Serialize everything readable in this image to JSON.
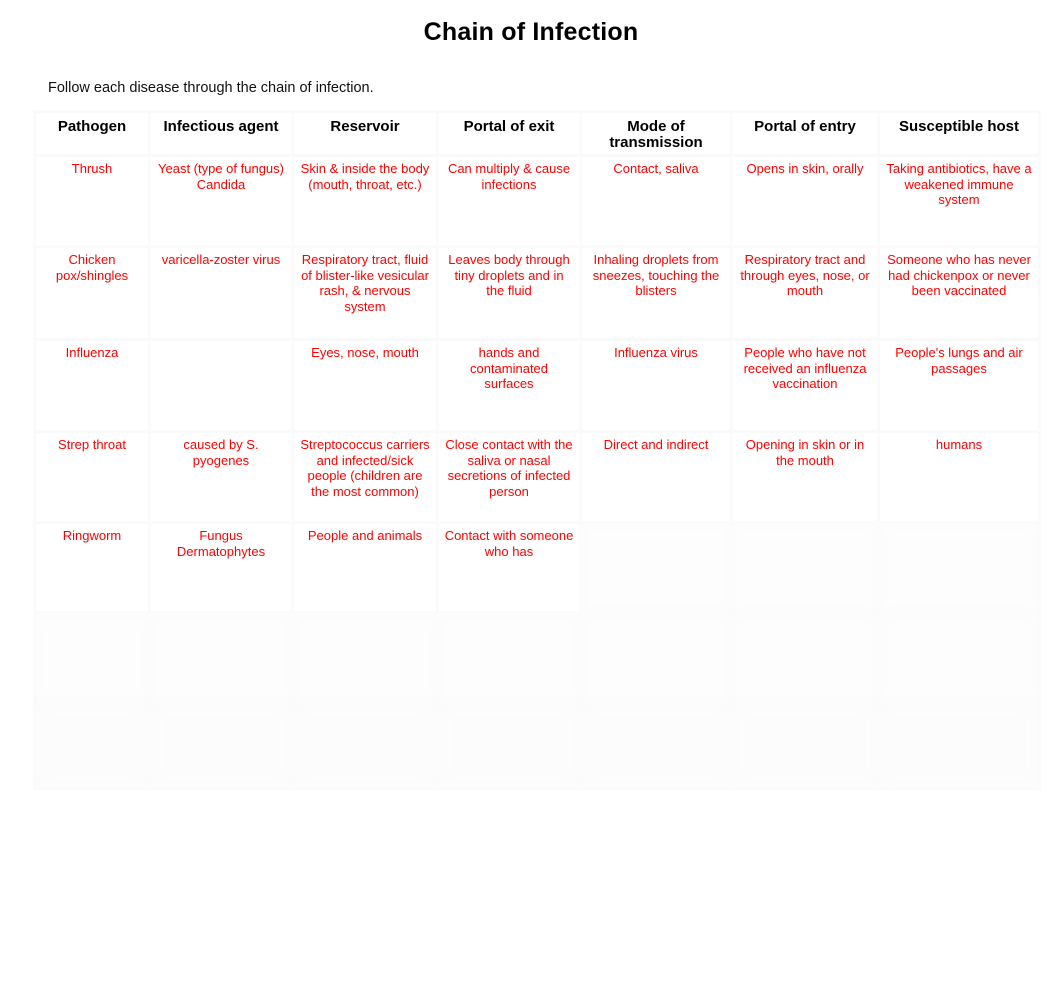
{
  "document": {
    "title": "Chain of Infection",
    "instruction": "Follow each disease through the chain of infection."
  },
  "table": {
    "headers": [
      "Pathogen",
      "Infectious agent",
      "Reservoir",
      "Portal of exit",
      "Mode of transmission",
      "Portal of entry",
      "Susceptible host"
    ],
    "rows": [
      {
        "pathogen": "Thrush",
        "infectious_agent": "Yeast (type of fungus) Candida",
        "reservoir": "Skin & inside the body (mouth, throat, etc.)",
        "portal_of_exit": "Can multiply & cause infections",
        "mode_of_transmission": "Contact, saliva",
        "portal_of_entry": "Opens in skin, orally",
        "susceptible_host": "Taking antibiotics, have a weakened immune system"
      },
      {
        "pathogen": "Chicken pox/shingles",
        "infectious_agent": "varicella-zoster virus",
        "reservoir": "Respiratory tract, fluid of blister-like vesicular rash, & nervous system",
        "portal_of_exit": "Leaves body through tiny droplets and in the fluid",
        "mode_of_transmission": "Inhaling droplets from sneezes, touching the blisters",
        "portal_of_entry": "Respiratory tract and through eyes, nose, or mouth",
        "susceptible_host": "Someone who has never had chickenpox or never been vaccinated"
      },
      {
        "pathogen": "Influenza",
        "infectious_agent": "",
        "reservoir": "Eyes, nose, mouth",
        "portal_of_exit": "hands and contaminated surfaces",
        "mode_of_transmission": "Influenza virus",
        "portal_of_entry": "People who have not received an influenza vaccination",
        "susceptible_host": "People's lungs and air passages"
      },
      {
        "pathogen": "Strep throat",
        "infectious_agent": "caused by S. pyogenes",
        "reservoir": "Streptococcus carriers and infected/sick people (children are the most common)",
        "portal_of_exit": "Close contact with the saliva or nasal secretions of infected person",
        "mode_of_transmission": "Direct and indirect",
        "portal_of_entry": "Opening in skin or in the mouth",
        "susceptible_host": "humans"
      },
      {
        "pathogen": "Ringworm",
        "infectious_agent": "Fungus Dermatophytes",
        "reservoir": "People and animals",
        "portal_of_exit": "Contact with someone who has",
        "mode_of_transmission": "",
        "portal_of_entry": "",
        "susceptible_host": ""
      },
      {
        "pathogen": "",
        "infectious_agent": "",
        "reservoir": "",
        "portal_of_exit": "",
        "mode_of_transmission": "",
        "portal_of_entry": "",
        "susceptible_host": ""
      },
      {
        "pathogen": "",
        "infectious_agent": "",
        "reservoir": "",
        "portal_of_exit": "",
        "mode_of_transmission": "",
        "portal_of_entry": "",
        "susceptible_host": ""
      }
    ]
  },
  "colors": {
    "answer_text": "#ff0000",
    "header_text": "#000000",
    "page_background": "#ffffff",
    "grid_line": "#fafafa"
  }
}
